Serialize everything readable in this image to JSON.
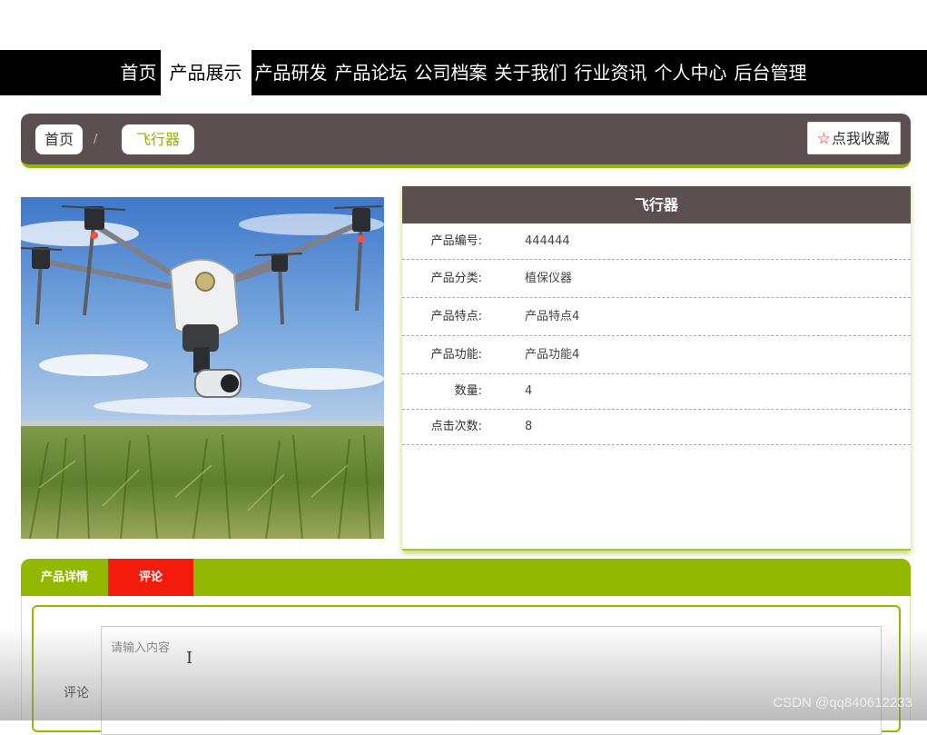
{
  "nav": {
    "items": [
      {
        "label": "首页"
      },
      {
        "label": "产品展示"
      },
      {
        "label": "产品研发"
      },
      {
        "label": "产品论坛"
      },
      {
        "label": "公司档案"
      },
      {
        "label": "关于我们"
      },
      {
        "label": "行业资讯"
      },
      {
        "label": "个人中心"
      },
      {
        "label": "后台管理"
      }
    ],
    "active_index": 1
  },
  "breadcrumb": {
    "home": "首页",
    "separator": "/",
    "current": "飞行器"
  },
  "favorite_button": {
    "icon": "star-icon",
    "label": "点我收藏"
  },
  "product": {
    "title": "飞行器",
    "fields": [
      {
        "label": "产品编号:",
        "value": "444444"
      },
      {
        "label": "产品分类:",
        "value": "植保仪器"
      },
      {
        "label": "产品特点:",
        "value": "产品特点4"
      },
      {
        "label": "产品功能:",
        "value": "产品功能4"
      },
      {
        "label": "数量:",
        "value": "4"
      },
      {
        "label": "点击次数:",
        "value": "8"
      }
    ]
  },
  "tabs": {
    "detail": "产品详情",
    "comment": "评论",
    "active": "comment"
  },
  "comment": {
    "label": "评论",
    "placeholder": "请输入内容",
    "value": ""
  },
  "watermark": "CSDN @qq840612233",
  "colors": {
    "accent": "#92b800",
    "header_bg": "#5c4f4f",
    "active_tab": "#f21b0c",
    "nav_bg": "#000000"
  }
}
